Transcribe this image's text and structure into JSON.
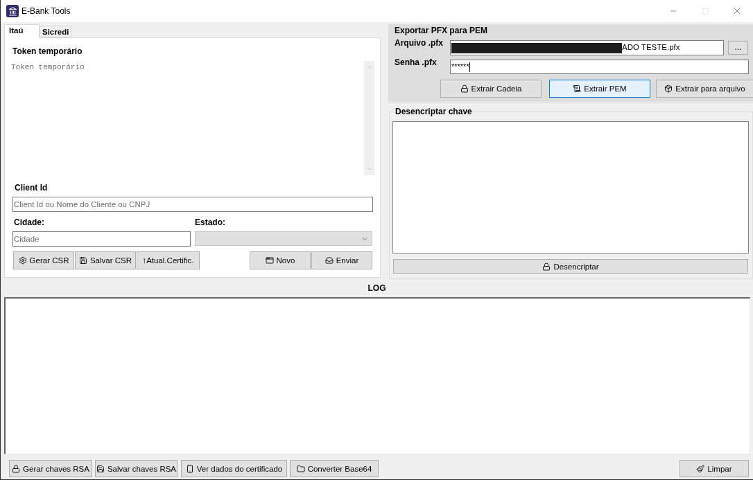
{
  "window": {
    "title": "E-Bank Tools",
    "controls": [
      {
        "kind": "minimize",
        "disabled": false
      },
      {
        "kind": "maximize",
        "disabled": true
      },
      {
        "kind": "close",
        "disabled": false
      }
    ]
  },
  "tabs": [
    {
      "label": "Itaú",
      "selected": true
    },
    {
      "label": "Sicredi",
      "selected": false
    }
  ],
  "itau": {
    "token": {
      "label": "Token temporário",
      "placeholder": "Token temporário"
    },
    "client_id": {
      "label": "Client Id",
      "placeholder": "Client Id ou Nome do Cliente ou CNPJ"
    },
    "cidade": {
      "label": "Cidade:",
      "placeholder": "Cidade"
    },
    "estado": {
      "label": "Estado:",
      "disabled": true
    },
    "buttons_left": [
      {
        "label": "Gerar CSR"
      },
      {
        "label": "Salvar CSR"
      },
      {
        "label": "↑Atual.Certific."
      }
    ],
    "buttons_right": [
      {
        "label": "Novo"
      },
      {
        "label": "Enviar"
      }
    ]
  },
  "pfx_export": {
    "title": "Exportar PFX para PEM",
    "arquivo": {
      "label": "Arquivo .pfx",
      "value": "ADO TESTE.pfx",
      "redacted": true
    },
    "browse_button": "...",
    "senha": {
      "label": "Senha .pfx",
      "value": "******"
    },
    "buttons": [
      {
        "label": "Extrair Cadeia",
        "focused": false
      },
      {
        "label": "Extrair PEM",
        "focused": true
      },
      {
        "label": "Extrair para arquivo",
        "focused": false
      }
    ]
  },
  "decrypt": {
    "title": "Desencriptar chave",
    "button": "Desencriptar"
  },
  "log": {
    "title": "LOG"
  },
  "bottom_bar": {
    "left": [
      {
        "label": "Gerar chaves RSA"
      },
      {
        "label": "Salvar chaves RSA"
      },
      {
        "label": "Ver dados do certificado"
      },
      {
        "label": "Converter Base64"
      }
    ],
    "right": [
      {
        "label": "Limpar"
      }
    ]
  }
}
